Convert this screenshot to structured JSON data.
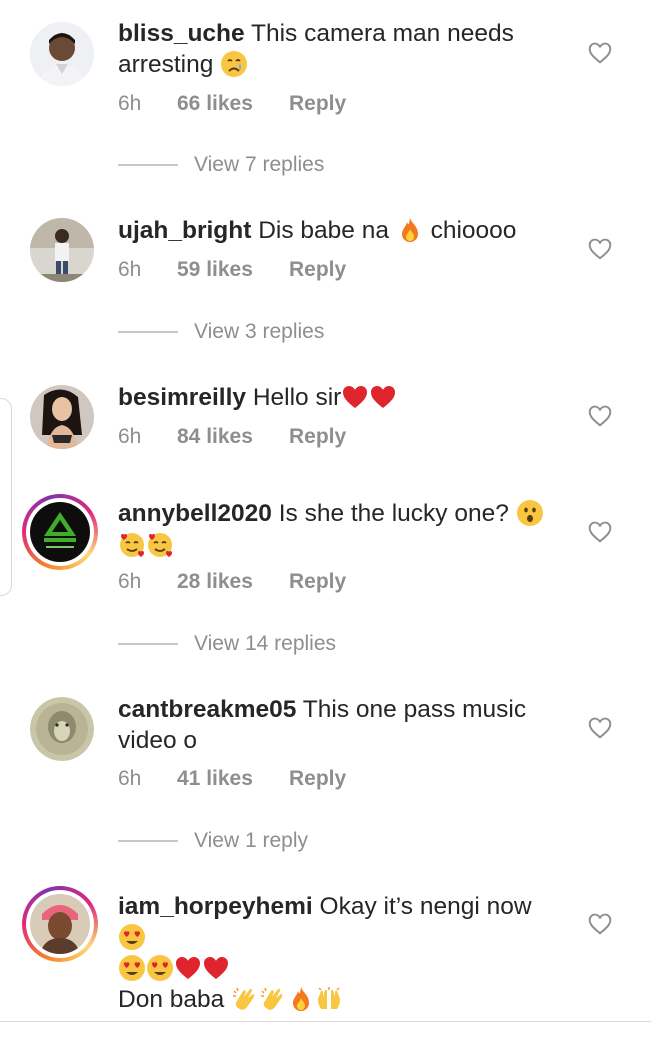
{
  "comments": [
    {
      "username": "bliss_uche",
      "text": "This camera man needs arresting",
      "emoji_after": [
        "crying-face"
      ],
      "time": "6h",
      "likes": "66 likes",
      "reply": "Reply",
      "view_replies": "View 7 replies"
    },
    {
      "username": "ujah_bright",
      "text_before": "Dis babe na",
      "emoji_mid": [
        "fire"
      ],
      "text_after": "chioooo",
      "time": "6h",
      "likes": "59 likes",
      "reply": "Reply",
      "view_replies": "View 3 replies"
    },
    {
      "username": "besimreilly",
      "text": "Hello sir",
      "emoji_after": [
        "red-heart",
        "red-heart"
      ],
      "time": "6h",
      "likes": "84 likes",
      "reply": "Reply"
    },
    {
      "username": "annybell2020",
      "text": "Is she the lucky one?",
      "emoji_after": [
        "astonished-face",
        "smiling-face-with-hearts",
        "smiling-face-with-hearts"
      ],
      "time": "6h",
      "likes": "28 likes",
      "reply": "Reply",
      "view_replies": "View 14 replies"
    },
    {
      "username": "cantbreakme05",
      "text": "This one pass music video o",
      "time": "6h",
      "likes": "41 likes",
      "reply": "Reply",
      "view_replies": "View 1 reply"
    },
    {
      "username": "iam_horpeyhemi",
      "text": "Okay it’s nengi now",
      "emoji_after": [
        "heart-eyes",
        "heart-eyes",
        "heart-eyes",
        "red-heart",
        "red-heart"
      ],
      "extra_line": "Don baba",
      "extra_emoji": [
        "clapping-hands",
        "clapping-hands",
        "fire",
        "raising-hands"
      ]
    }
  ],
  "colors": {
    "text": "#262626",
    "secondary": "#8e8e8e",
    "divider": "#c7c7c7",
    "story_ring": [
      "#f58529",
      "#dd2a7b",
      "#8134af"
    ]
  },
  "icons": [
    "heart-outline-icon",
    "avatar"
  ]
}
